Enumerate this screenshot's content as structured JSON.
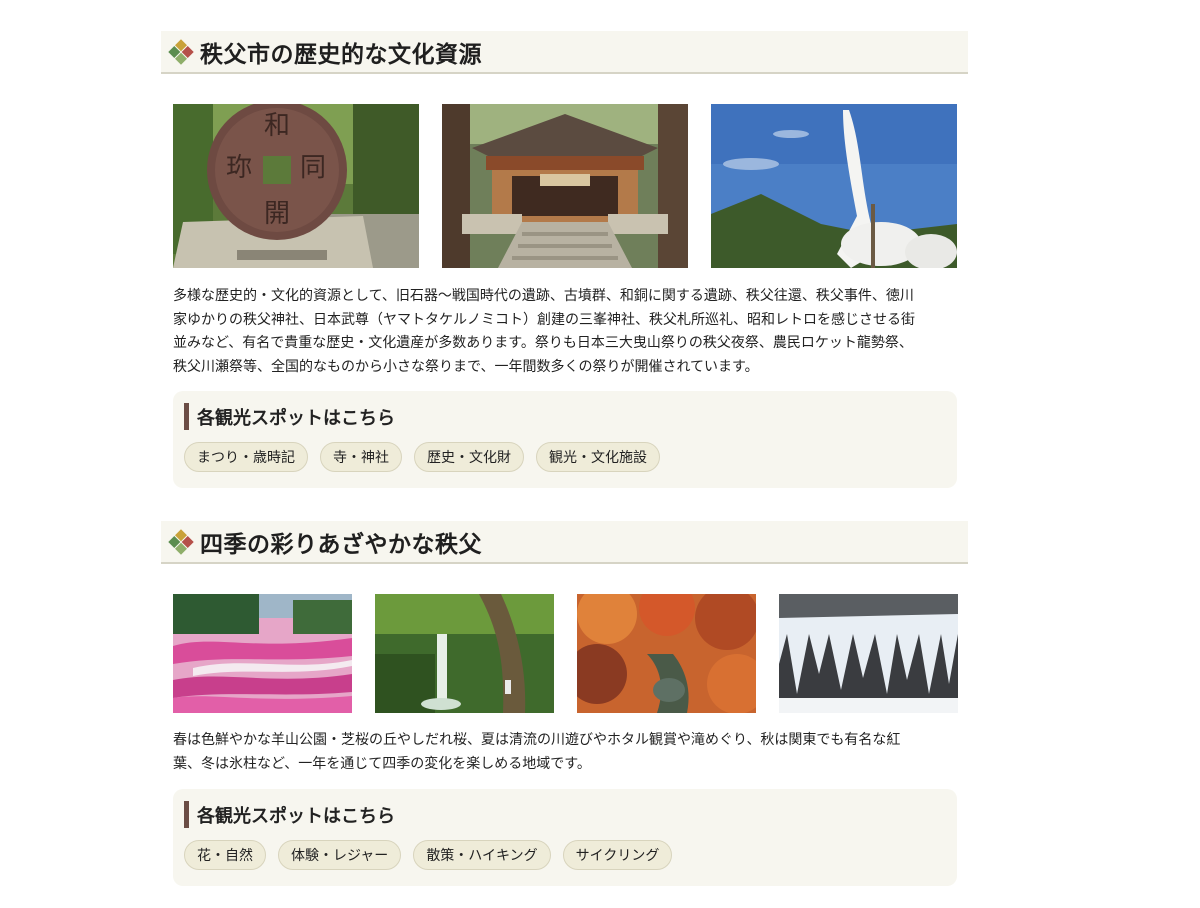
{
  "sections": [
    {
      "title": "秩父市の歴史的な文化資源",
      "description_lines": [
        "多様な歴史的・文化的資源として、旧石器〜戦国時代の遺跡、古墳群、和銅に関する遺跡、秩父往還、秩父事件、徳川",
        "家ゆかりの秩父神社、日本武尊（ヤマトタケルノミコト）創建の三峯神社、秩父札所巡礼、昭和レトロを感じさせる街",
        "並みなど、有名で貴重な歴史・文化遺産が多数あります。祭りも日本三大曳山祭りの秩父夜祭、農民ロケット龍勢祭、",
        "秩父川瀬祭等、全国的なものから小さな祭りまで、一年間数多くの祭りが開催されています。"
      ],
      "spots_title": "各観光スポットはこちら",
      "tags": [
        "まつり・歳時記",
        "寺・神社",
        "歴史・文化財",
        "観光・文化施設"
      ]
    },
    {
      "title": "四季の彩りあざやかな秩父",
      "description_lines": [
        "春は色鮮やかな羊山公園・芝桜の丘やしだれ桜、夏は清流の川遊びやホタル観賞や滝めぐり、秋は関東でも有名な紅",
        "葉、冬は氷柱など、一年を通じて四季の変化を楽しめる地域です。"
      ],
      "spots_title": "各観光スポットはこちら",
      "tags": [
        "花・自然",
        "体験・レジャー",
        "散策・ハイキング",
        "サイクリング"
      ]
    }
  ],
  "photo_coin_text": [
    "和",
    "同",
    "開",
    "珎"
  ],
  "colors": {
    "heading_bg": "#f7f6ef",
    "heading_border": "#d6d4c6",
    "spot_box_bg": "#f7f6ef",
    "accent_bar": "#6b4d45",
    "tag_bg": "#efecd9"
  }
}
